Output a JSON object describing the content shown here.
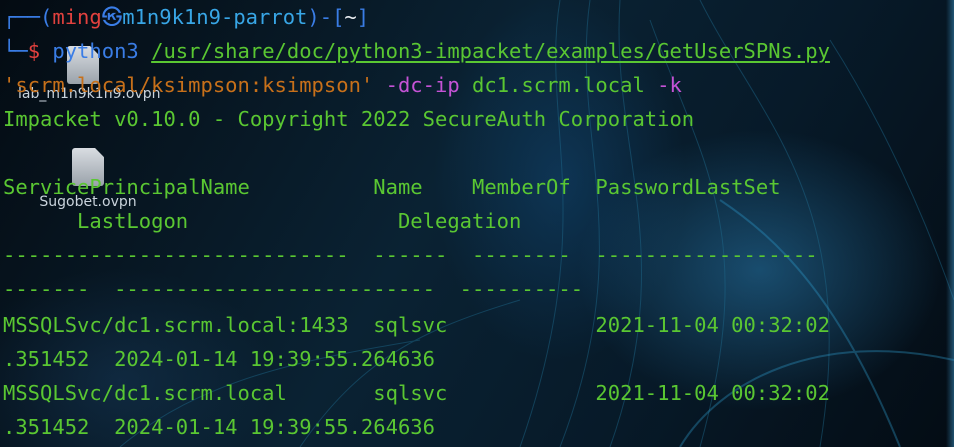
{
  "desktop": {
    "icons": [
      {
        "label": "lab_m1n9k1n9.ovpn",
        "icon": "ovpn-file-icon"
      },
      {
        "label": "Sugobet.ovpn",
        "icon": "ovpn-file-icon"
      }
    ]
  },
  "terminal": {
    "prompt": {
      "box_top": "┌──(",
      "user": "ming",
      "at_icon": "㉿",
      "host": "m1n9k1n9-parrot",
      "mid": ")-[",
      "path": "~",
      "end": "]",
      "box_bottom": "└─",
      "dollar": "$"
    },
    "command": {
      "program": "python3",
      "script_path": "/usr/share/doc/python3-impacket/examples/GetUserSPNs.py",
      "credential": "'scrm.local/ksimpson:ksimpson'",
      "dc_ip_flag": "-dc-ip",
      "dc_host": "dc1.scrm.local",
      "kerberos_flag": "-k"
    },
    "banner": "Impacket v0.10.0 - Copyright 2022 SecureAuth Corporation",
    "table": {
      "header_line_1": "ServicePrincipalName          Name    MemberOf  PasswordLastSet",
      "header_line_2": "      LastLogon                 Delegation",
      "separator_line_1": "----------------------------  ------  --------  ------------------",
      "separator_line_2": "-------  --------------------------  ----------",
      "rows": [
        {
          "line_1": "MSSQLSvc/dc1.scrm.local:1433  sqlsvc            2021-11-04 00:32:02",
          "line_2": ".351452  2024-01-14 19:39:55.264636"
        },
        {
          "line_1": "MSSQLSvc/dc1.scrm.local       sqlsvc            2021-11-04 00:32:02",
          "line_2": ".351452  2024-01-14 19:39:55.264636"
        }
      ]
    }
  }
}
